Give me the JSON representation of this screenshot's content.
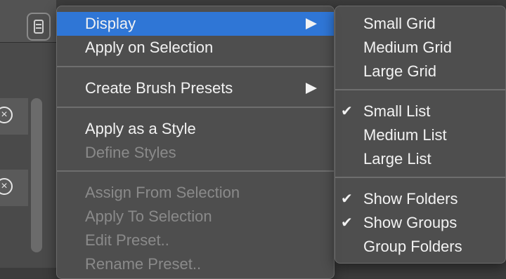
{
  "main_menu": {
    "items": [
      {
        "label": "Display",
        "submenu": true,
        "highlighted": true
      },
      {
        "label": "Apply on Selection"
      },
      {
        "label": "Create Brush Presets",
        "submenu": true
      },
      {
        "label": "Apply as a Style"
      },
      {
        "label": "Define Styles",
        "disabled": true
      },
      {
        "label": "Assign From Selection",
        "disabled": true
      },
      {
        "label": "Apply To Selection",
        "disabled": true
      },
      {
        "label": "Edit Preset..",
        "disabled": true
      },
      {
        "label": "Rename Preset..",
        "disabled": true
      }
    ]
  },
  "submenu": {
    "items": [
      {
        "label": "Small Grid",
        "checked": false
      },
      {
        "label": "Medium Grid",
        "checked": false
      },
      {
        "label": "Large Grid",
        "checked": false
      },
      {
        "label": "Small List",
        "checked": true
      },
      {
        "label": "Medium List",
        "checked": false
      },
      {
        "label": "Large List",
        "checked": false
      },
      {
        "label": "Show Folders",
        "checked": true
      },
      {
        "label": "Show Groups",
        "checked": true
      },
      {
        "label": "Group Folders",
        "checked": false
      }
    ]
  },
  "colors": {
    "highlight": "#2f76d6",
    "menu_bg": "#4e4e4e",
    "text": "#f2f2f2",
    "disabled_text": "#8a8a8a"
  }
}
